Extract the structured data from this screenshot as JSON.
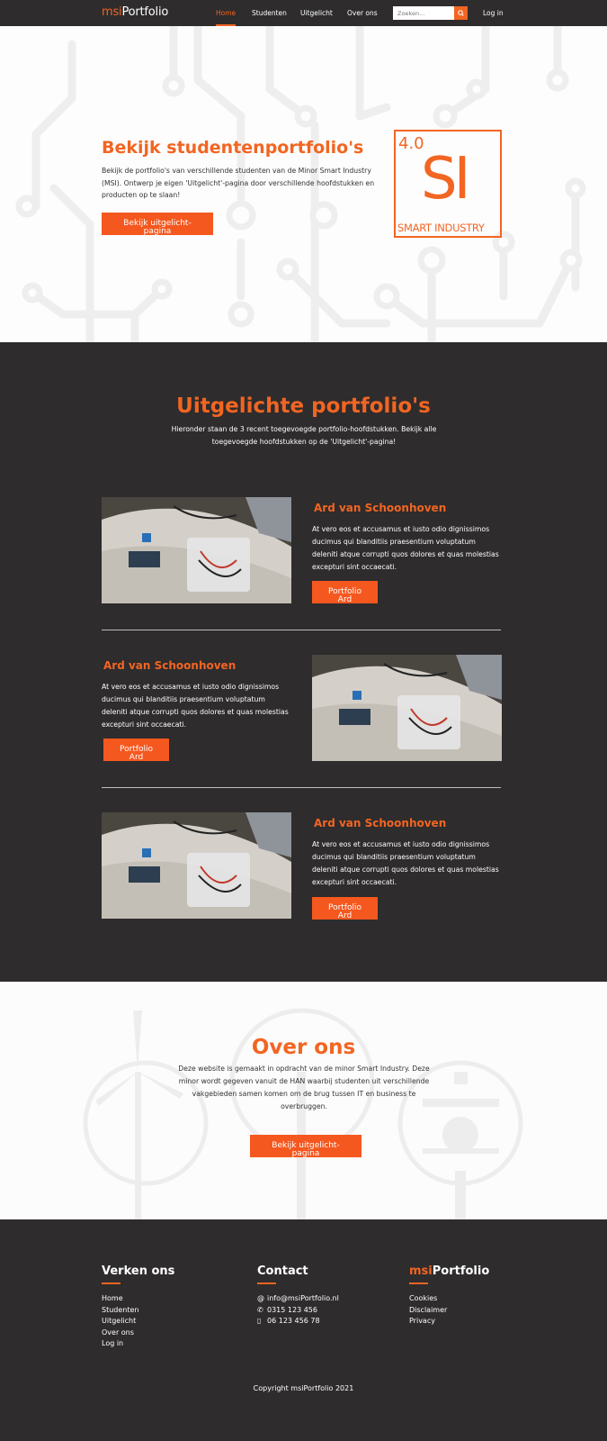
{
  "nav": {
    "brand_prefix": "msi",
    "brand_main": "Portfolio",
    "links": [
      "Home",
      "Studenten",
      "Uitgelicht",
      "Over ons"
    ],
    "search_placeholder": "Zoeken...",
    "login": "Log in"
  },
  "hero": {
    "title": "Bekijk studentenportfolio's",
    "text": "Bekijk de portfolio's van verschillende studenten van de Minor Smart Industry (MSI). Ontwerp je eigen 'Uitgelicht'-pagina door verschillende hoofdstukken en producten op te slaan!",
    "button": "Bekijk uitgelicht-pagina",
    "logo": {
      "version": "4.0",
      "letters": "SI",
      "subtitle": "SMART INDUSTRY"
    }
  },
  "featured": {
    "title": "Uitgelichte portfolio's",
    "intro": "Hieronder staan de 3 recent toegevoegde portfolio-hoofdstukken. Bekijk alle toegevoegde hoofdstukken op de 'Uitgelicht'-pagina!",
    "entries": [
      {
        "name": "Ard van Schoonhoven",
        "text": "At vero eos et accusamus et iusto odio dignissimos ducimus qui blanditiis praesentium voluptatum deleniti atque corrupti quos dolores et quas molestias excepturi sint occaecati.",
        "button": "Portfolio Ard"
      },
      {
        "name": "Ard van Schoonhoven",
        "text": "At vero eos et accusamus et iusto odio dignissimos ducimus qui blanditiis praesentium voluptatum deleniti atque corrupti quos dolores et quas molestias excepturi sint occaecati.",
        "button": "Portfolio Ard"
      },
      {
        "name": "Ard van Schoonhoven",
        "text": "At vero eos et accusamus et iusto odio dignissimos ducimus qui blanditiis praesentium voluptatum deleniti atque corrupti quos dolores et quas molestias excepturi sint occaecati.",
        "button": "Portfolio Ard"
      }
    ]
  },
  "about": {
    "title": "Over ons",
    "text": "Deze website is gemaakt in opdracht van de minor Smart Industry. Deze minor wordt gegeven vanuit de HAN waarbij studenten uit verschillende vakgebieden samen komen om de brug tussen IT en business te overbruggen.",
    "button": "Bekijk uitgelicht-pagina"
  },
  "footer": {
    "explore_title": "Verken ons",
    "explore_links": [
      "Home",
      "Studenten",
      "Uitgelicht",
      "Over ons",
      "Log in"
    ],
    "contact_title": "Contact",
    "contact_email": "info@msiPortfolio.nl",
    "contact_phone": "0315 123 456",
    "contact_mobile": "06 123 456 78",
    "brand_prefix": "msi",
    "brand_main": "Portfolio",
    "brand_links": [
      "Cookies",
      "Disclaimer",
      "Privacy"
    ],
    "copyright": "Copyright msiPortfolio 2021"
  },
  "colors": {
    "accent": "#f26522",
    "dark": "#2e2c2d",
    "light": "#fcfcfc"
  }
}
